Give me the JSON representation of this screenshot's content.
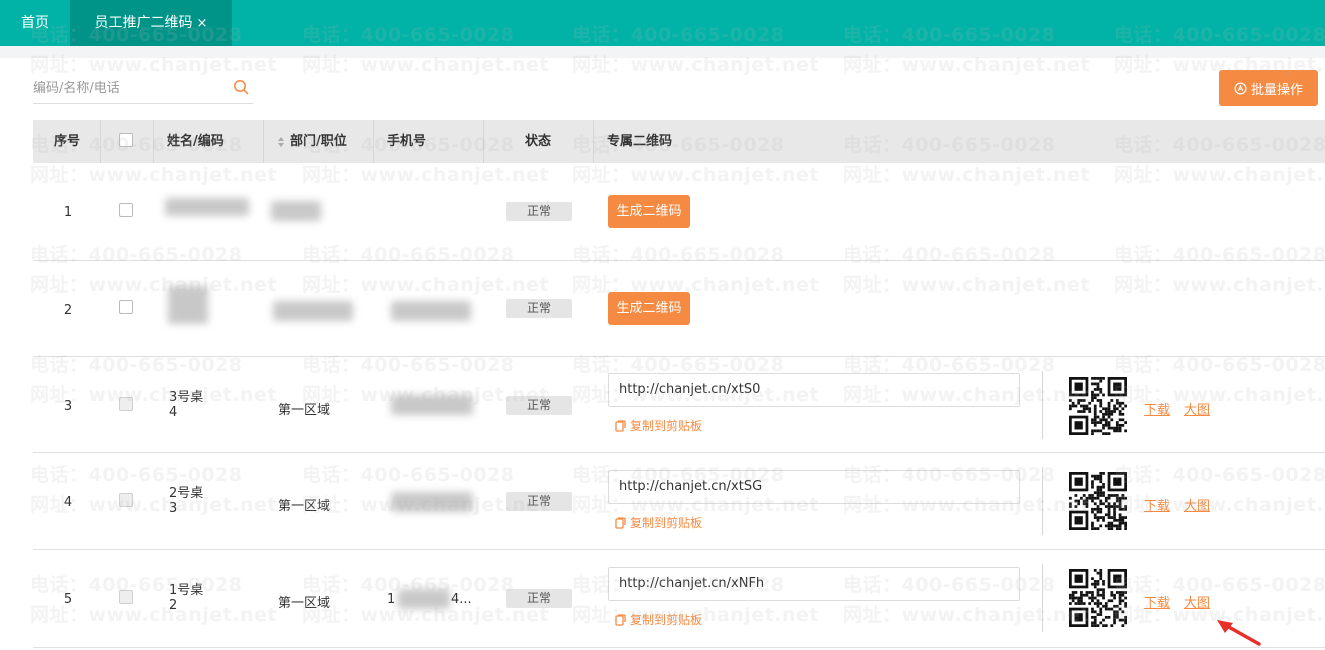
{
  "tabs": [
    {
      "label": "首页"
    },
    {
      "label": "员工推广二维码",
      "close": "×"
    }
  ],
  "watermark": {
    "phone": "电话：400-665-0028",
    "site": "网址：www.chanjet.net"
  },
  "search": {
    "placeholder": "编码/名称/电话"
  },
  "batch_button": {
    "label": "批量操作"
  },
  "table": {
    "headers": {
      "index": "序号",
      "name": "姓名/编码",
      "dept": "部门/职位",
      "phone": "手机号",
      "status": "状态",
      "qrcode": "专属二维码"
    },
    "rows": [
      {
        "index": "1",
        "status": "正常",
        "action": "生成二维码"
      },
      {
        "index": "2",
        "status": "正常",
        "action": "生成二维码"
      },
      {
        "index": "3",
        "name": "3号桌",
        "code": "4",
        "dept": "第一区域",
        "status": "正常",
        "url": "http://chanjet.cn/xtS0",
        "copy": "复制到剪贴板",
        "download": "下载",
        "large": "大图"
      },
      {
        "index": "4",
        "name": "2号桌",
        "code": "3",
        "dept": "第一区域",
        "status": "正常",
        "url": "http://chanjet.cn/xtSG",
        "copy": "复制到剪贴板",
        "download": "下载",
        "large": "大图"
      },
      {
        "index": "5",
        "name": "1号桌",
        "code": "2",
        "dept": "第一区域",
        "phone_head": "1",
        "phone_tail": "4...",
        "status": "正常",
        "url": "http://chanjet.cn/xNFh",
        "copy": "复制到剪贴板",
        "download": "下载",
        "large": "大图"
      }
    ]
  },
  "colors": {
    "primary": "#00b3a6",
    "primary_dark": "#009489",
    "accent": "#f58a42"
  }
}
